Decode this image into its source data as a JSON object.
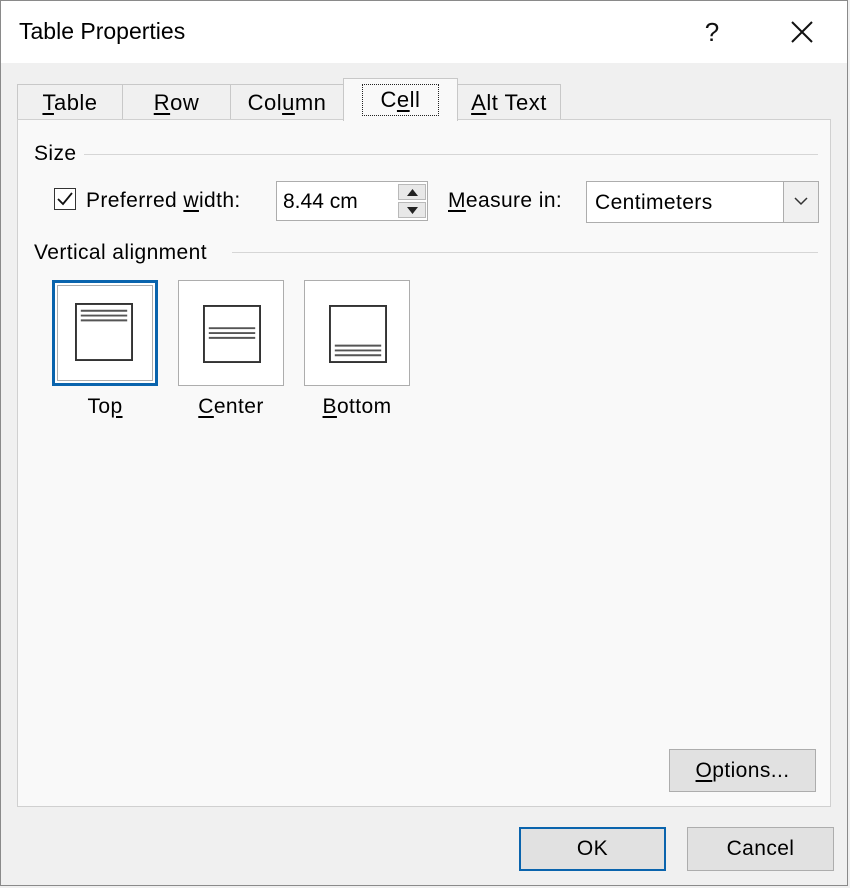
{
  "window": {
    "title": "Table Properties",
    "help_label": "?"
  },
  "tabs": [
    {
      "pre": "",
      "ul": "T",
      "post": "able"
    },
    {
      "pre": "",
      "ul": "R",
      "post": "ow"
    },
    {
      "pre": "Col",
      "ul": "u",
      "post": "mn"
    },
    {
      "pre": "C",
      "ul": "e",
      "post": "ll"
    },
    {
      "pre": "",
      "ul": "A",
      "post": "lt Text"
    }
  ],
  "size": {
    "group_label": "Size",
    "preferred_width": {
      "checked": true,
      "pre": "Preferred ",
      "ul": "w",
      "post": "idth:"
    },
    "width_value": "8.44 cm",
    "measure": {
      "ul": "M",
      "post": "easure in:"
    },
    "measure_value": "Centimeters"
  },
  "vertical_alignment": {
    "group_label": "Vertical alignment",
    "options": [
      {
        "pre": "To",
        "ul": "p",
        "post": "",
        "selected": true
      },
      {
        "pre": "",
        "ul": "C",
        "post": "enter",
        "selected": false
      },
      {
        "pre": "",
        "ul": "B",
        "post": "ottom",
        "selected": false
      }
    ]
  },
  "buttons": {
    "options": {
      "ul": "O",
      "post": "ptions..."
    },
    "ok": "OK",
    "cancel": "Cancel"
  },
  "colors": {
    "accent": "#0a64ad",
    "panel": "#f9f9f9",
    "window": "#f0f0f0"
  }
}
